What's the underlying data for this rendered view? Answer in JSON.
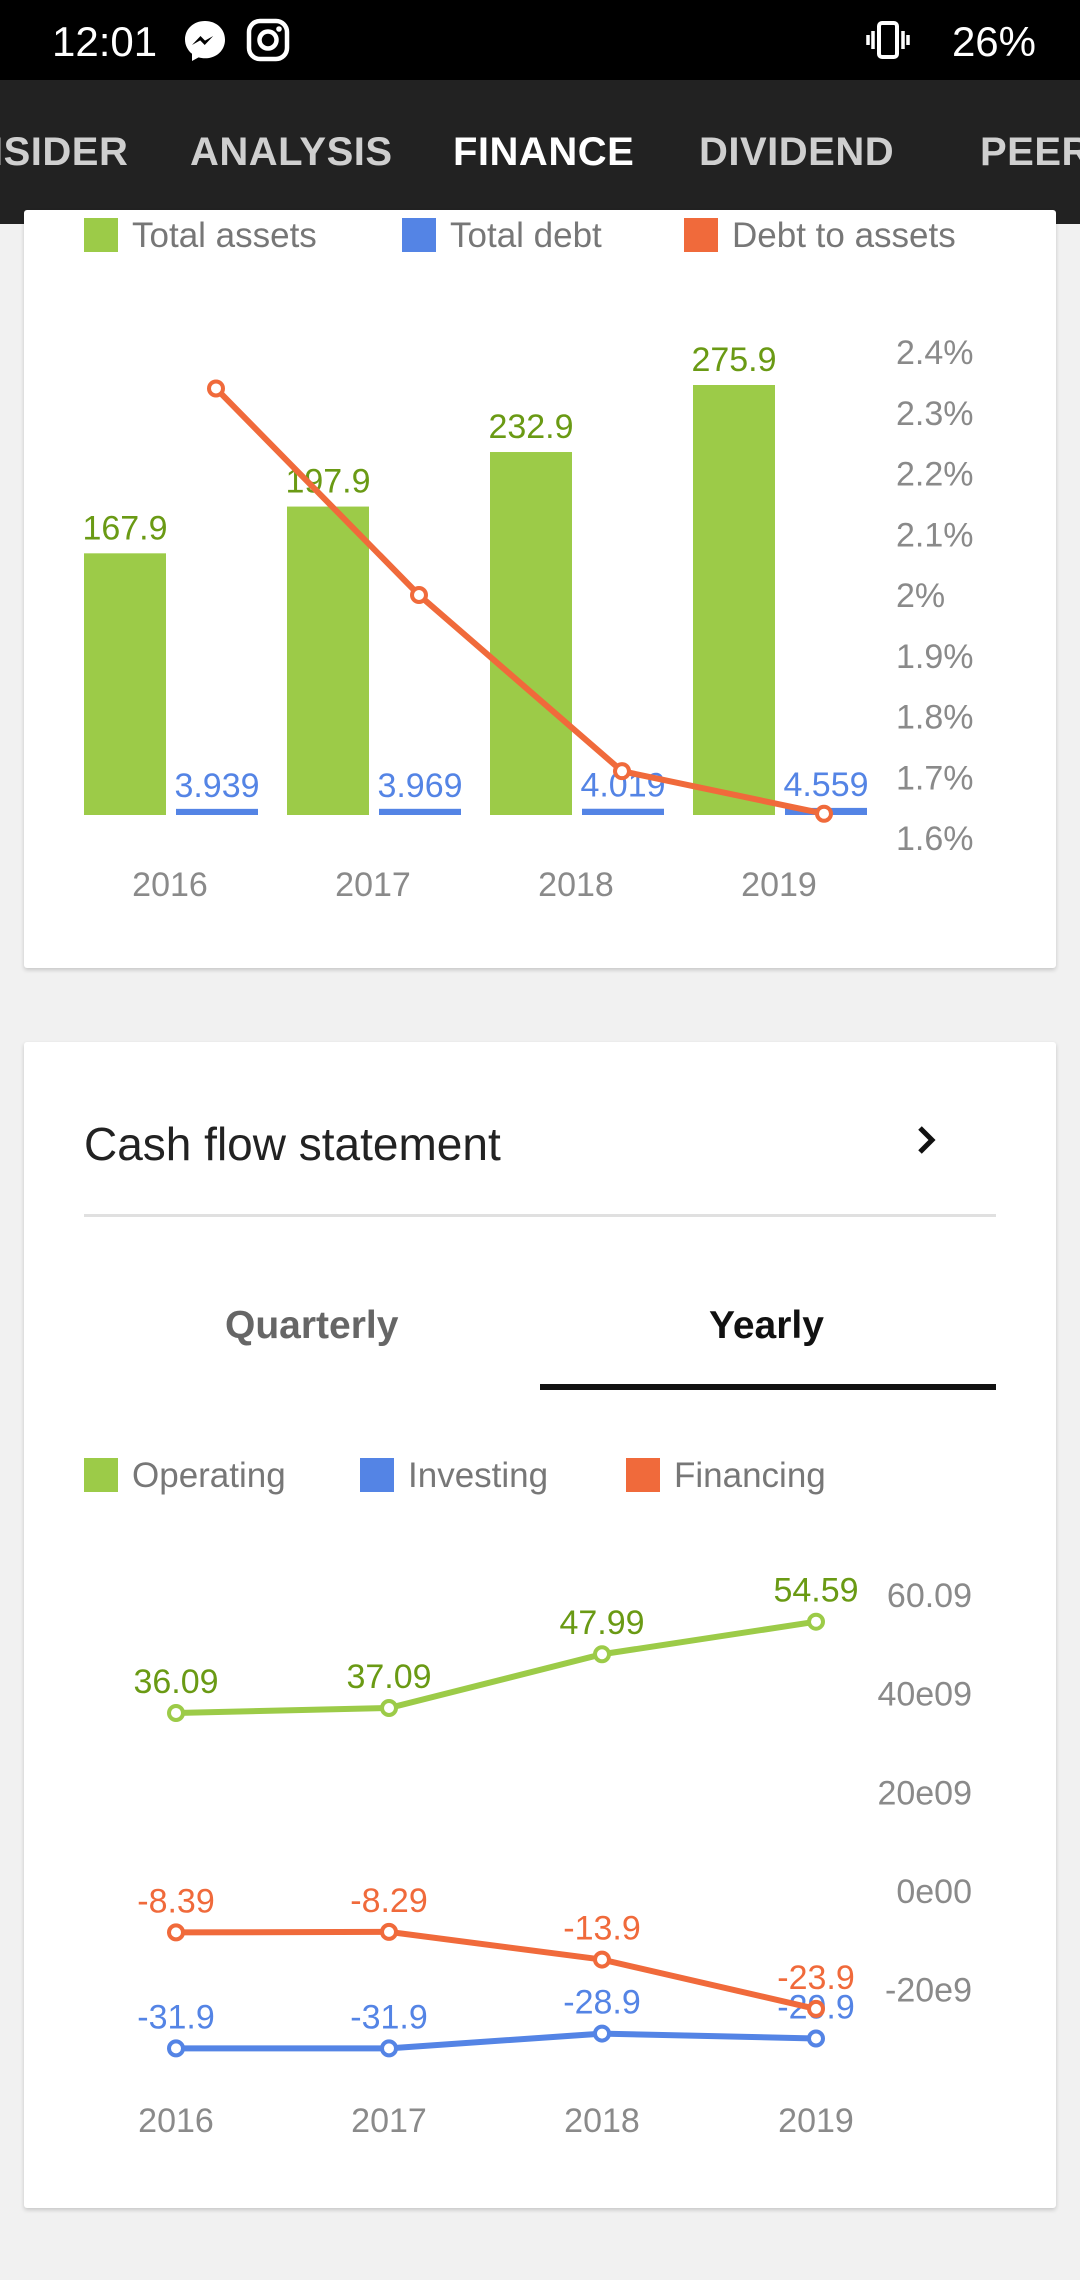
{
  "status": {
    "time": "12:01",
    "icons": [
      "messenger-icon",
      "instagram-icon",
      "vibrate-icon"
    ],
    "battery": "26%"
  },
  "tabs": [
    {
      "label": "ISIDER"
    },
    {
      "label": "ANALYSIS"
    },
    {
      "label": "FINANCE",
      "active": true
    },
    {
      "label": "DIVIDEND"
    },
    {
      "label": "PEER"
    }
  ],
  "colors": {
    "green": "#9ccb48",
    "blue": "#5484e5",
    "orange": "#f06a3b",
    "green_text": "#6a9a14"
  },
  "balance_card": {
    "legend": [
      "Total assets",
      "Total debt",
      "Debt to assets"
    ]
  },
  "cashflow_card": {
    "title": "Cash flow statement",
    "segments": [
      "Quarterly",
      "Yearly"
    ],
    "active_segment": "Yearly",
    "legend": [
      "Operating",
      "Investing",
      "Financing"
    ]
  },
  "chart_data": [
    {
      "type": "bar",
      "categories": [
        "2016",
        "2017",
        "2018",
        "2019"
      ],
      "series": [
        {
          "name": "Total assets",
          "values": [
            167.9,
            197.9,
            232.9,
            275.9
          ],
          "labels": [
            "167.9",
            "197.9",
            "232.9",
            "275.9"
          ],
          "color": "#9ccb48"
        },
        {
          "name": "Total debt",
          "values": [
            3.939,
            3.969,
            4.019,
            4.559
          ],
          "labels": [
            "3.939",
            "3.969",
            "4.019",
            "4.559"
          ],
          "color": "#5484e5"
        },
        {
          "name": "Debt to assets",
          "type": "line",
          "axis": "right",
          "values": [
            2.34,
            2.0,
            1.71,
            1.64
          ],
          "color": "#f06a3b"
        }
      ],
      "right_axis": {
        "ticks": [
          "2.4%",
          "2.3%",
          "2.2%",
          "2.1%",
          "2%",
          "1.9%",
          "1.8%",
          "1.7%",
          "1.6%"
        ],
        "range": [
          1.6,
          2.4
        ]
      },
      "left_range": [
        0,
        275.9
      ]
    },
    {
      "type": "line",
      "categories": [
        "2016",
        "2017",
        "2018",
        "2019"
      ],
      "series": [
        {
          "name": "Operating",
          "values": [
            36.09,
            37.09,
            47.99,
            54.59
          ],
          "labels": [
            "36.09",
            "37.09",
            "47.99",
            "54.59"
          ],
          "color": "#9ccb48"
        },
        {
          "name": "Investing",
          "values": [
            -31.9,
            -31.9,
            -28.9,
            -29.9
          ],
          "labels": [
            "-31.9",
            "-31.9",
            "-28.9",
            "-29.9"
          ],
          "color": "#5484e5"
        },
        {
          "name": "Financing",
          "values": [
            -8.39,
            -8.29,
            -13.9,
            -23.9
          ],
          "labels": [
            "-8.39",
            "-8.29",
            "-13.9",
            "-23.9"
          ],
          "color": "#f06a3b"
        }
      ],
      "right_axis": {
        "ticks": [
          "60.09",
          "40e09",
          "20e09",
          "0e00",
          "-20e9"
        ],
        "values": [
          60,
          40,
          20,
          0,
          -20
        ]
      },
      "ylim": [
        -32,
        60
      ]
    }
  ]
}
